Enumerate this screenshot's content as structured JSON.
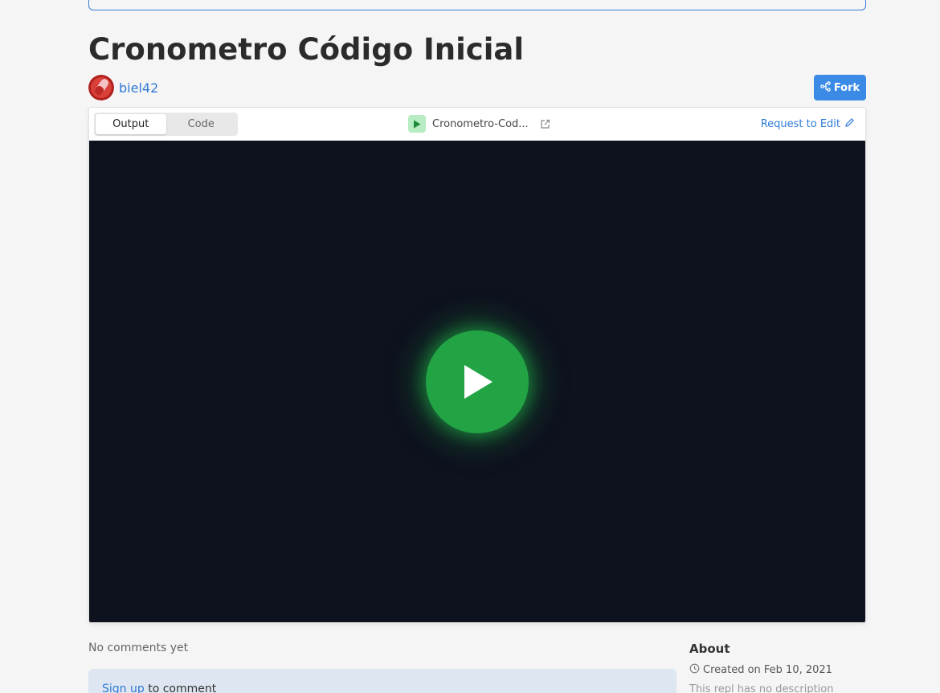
{
  "repl": {
    "title": "Cronometro Código Inicial",
    "author": "biel42",
    "fork_label": "Fork",
    "file_name": "Cronometro-Cod...",
    "request_edit_label": "Request to Edit"
  },
  "tabs": [
    {
      "label": "Output",
      "active": true
    },
    {
      "label": "Code",
      "active": false
    }
  ],
  "comments": {
    "empty_label": "No comments yet",
    "signup_link": "Sign up",
    "signup_suffix": " to comment"
  },
  "about": {
    "title": "About",
    "created": "Created on Feb 10, 2021",
    "description": "This repl has no description"
  },
  "colors": {
    "accent": "#3b8ae6",
    "link": "#2f7ad6",
    "output_bg": "#0e111e",
    "run_green": "#22a344"
  },
  "icons": [
    "play-icon",
    "fork-icon",
    "external-link-icon",
    "pencil-icon",
    "clock-icon"
  ]
}
